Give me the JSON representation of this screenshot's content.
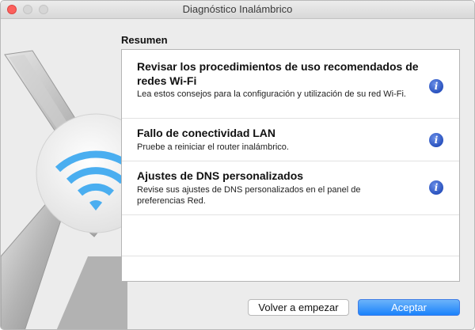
{
  "window": {
    "title": "Diagnóstico Inalámbrico"
  },
  "summary": {
    "heading": "Resumen",
    "items": [
      {
        "title": "Revisar los procedimientos de uso recomendados de redes Wi-Fi",
        "description": "Lea estos consejos para la configuración y utilización de su red Wi-Fi.",
        "icon": "info-icon"
      },
      {
        "title": "Fallo de conectividad LAN",
        "description": "Pruebe a reiniciar el router inalámbrico.",
        "icon": "info-icon"
      },
      {
        "title": "Ajustes de DNS personalizados",
        "description": "Revise sus ajustes de DNS personalizados en el panel de preferencias Red.",
        "icon": "info-icon"
      }
    ]
  },
  "buttons": {
    "restart": "Volver a empezar",
    "accept": "Aceptar"
  },
  "colors": {
    "accent": "#1a82fb",
    "info": "#2a52be",
    "wifi": "#4aaef0",
    "close": "#fc605c"
  }
}
